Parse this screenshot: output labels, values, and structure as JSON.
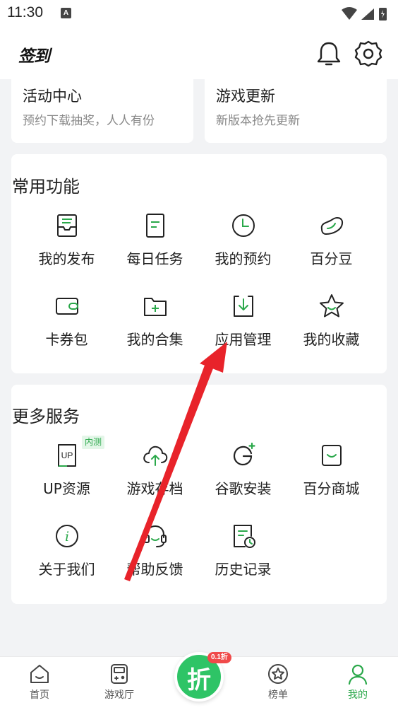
{
  "status_bar": {
    "time": "11:30",
    "notification_letter": "A"
  },
  "header": {
    "logo": "签到",
    "icons": [
      "bell-icon",
      "gear-icon"
    ]
  },
  "top_cards": [
    {
      "title": "活动中心",
      "subtitle": "预约下载抽奖，人人有份"
    },
    {
      "title": "游戏更新",
      "subtitle": "新版本抢先更新"
    }
  ],
  "common": {
    "title": "常用功能",
    "items": [
      {
        "label": "我的发布",
        "icon": "inbox-icon"
      },
      {
        "label": "每日任务",
        "icon": "task-doc-icon"
      },
      {
        "label": "我的预约",
        "icon": "clock-icon"
      },
      {
        "label": "百分豆",
        "icon": "bean-icon"
      },
      {
        "label": "卡券包",
        "icon": "wallet-icon"
      },
      {
        "label": "我的合集",
        "icon": "folder-plus-icon"
      },
      {
        "label": "应用管理",
        "icon": "download-box-icon"
      },
      {
        "label": "我的收藏",
        "icon": "star-icon"
      }
    ]
  },
  "more": {
    "title": "更多服务",
    "badge": "内测",
    "items": [
      {
        "label": "UP资源",
        "icon": "up-resource-icon",
        "icon_text": "UP"
      },
      {
        "label": "游戏存档",
        "icon": "cloud-upload-icon"
      },
      {
        "label": "谷歌安装",
        "icon": "google-plus-icon"
      },
      {
        "label": "百分商城",
        "icon": "shop-bag-icon"
      },
      {
        "label": "关于我们",
        "icon": "info-icon",
        "icon_text": "i"
      },
      {
        "label": "帮助反馈",
        "icon": "headset-icon"
      },
      {
        "label": "历史记录",
        "icon": "history-doc-icon"
      }
    ]
  },
  "bottom_nav": {
    "items": [
      {
        "label": "首页",
        "icon": "home-icon"
      },
      {
        "label": "游戏厅",
        "icon": "gamepad-icon"
      },
      {
        "label": "榜单",
        "icon": "rank-star-icon"
      },
      {
        "label": "我的",
        "icon": "profile-icon",
        "active": true
      }
    ],
    "center": {
      "label": "折",
      "badge": "0.1折"
    }
  },
  "colors": {
    "accent": "#2aa84a",
    "fab": "#2ec466",
    "badge_red": "#f04a4a",
    "arrow": "#e8232a"
  }
}
